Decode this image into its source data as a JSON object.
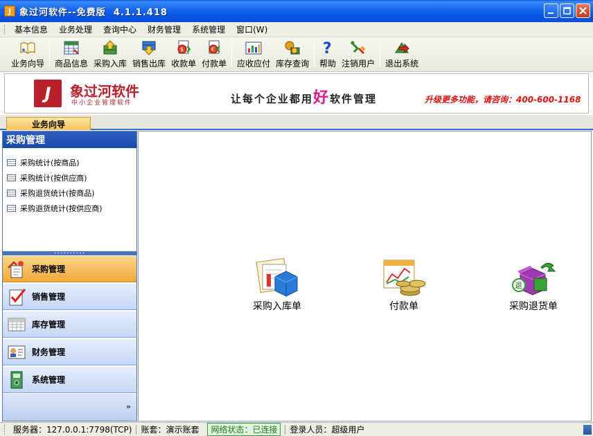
{
  "window": {
    "title": "象过河软件--免费版  4.1.1.418",
    "icon_name": "app-icon"
  },
  "menu": {
    "items": [
      "基本信息",
      "业务处理",
      "查询中心",
      "财务管理",
      "系统管理",
      "窗口(W)"
    ]
  },
  "toolbar": {
    "items": [
      {
        "label": "业务向导",
        "icon": "book-icon"
      },
      {
        "label": "商品信息",
        "icon": "grid-icon"
      },
      {
        "label": "采购入库",
        "icon": "inbound-icon"
      },
      {
        "label": "销售出库",
        "icon": "outbound-icon"
      },
      {
        "label": "收款单",
        "icon": "receipt-icon"
      },
      {
        "label": "付款单",
        "icon": "payment-icon"
      },
      {
        "label": "应收应付",
        "icon": "chart-icon"
      },
      {
        "label": "库存查询",
        "icon": "inventory-icon"
      },
      {
        "label": "帮助",
        "icon": "help-icon"
      },
      {
        "label": "注销用户",
        "icon": "logoff-icon"
      },
      {
        "label": "退出系统",
        "icon": "exit-icon"
      }
    ]
  },
  "banner": {
    "logo_letter": "J",
    "brand": "象过河软件",
    "brand_sub": "中小企业管理软件",
    "slogan_pre": "让每个企业都用",
    "slogan_hi": "好",
    "slogan_post": "软件管理",
    "hotline": "升级更多功能，请咨询：400-600-1168"
  },
  "tabs": {
    "active": "业务向导"
  },
  "left_panel": {
    "header": "采购管理",
    "reports": [
      "采购统计(按商品)",
      "采购统计(按供应商)",
      "采购退货统计(按商品)",
      "采购退货统计(按供应商)"
    ],
    "nav": [
      {
        "label": "采购管理",
        "icon": "purchase-icon",
        "active": true
      },
      {
        "label": "销售管理",
        "icon": "sales-check-icon",
        "active": false
      },
      {
        "label": "库存管理",
        "icon": "inventory-grid-icon",
        "active": false
      },
      {
        "label": "财务管理",
        "icon": "finance-card-icon",
        "active": false
      },
      {
        "label": "系统管理",
        "icon": "system-icon",
        "active": false
      }
    ],
    "more": "»"
  },
  "workspace": {
    "items": [
      {
        "label": "采购入库单",
        "icon": "purchase-inbound-icon"
      },
      {
        "label": "付款单",
        "icon": "coins-payment-icon"
      },
      {
        "label": "采购退货单",
        "icon": "purchase-return-icon"
      }
    ]
  },
  "status": {
    "server": "服务器：127.0.0.1:7798(TCP)",
    "account": "账套：演示账套",
    "network": "网络状态：已连接",
    "user": "登录人员：超级用户"
  }
}
